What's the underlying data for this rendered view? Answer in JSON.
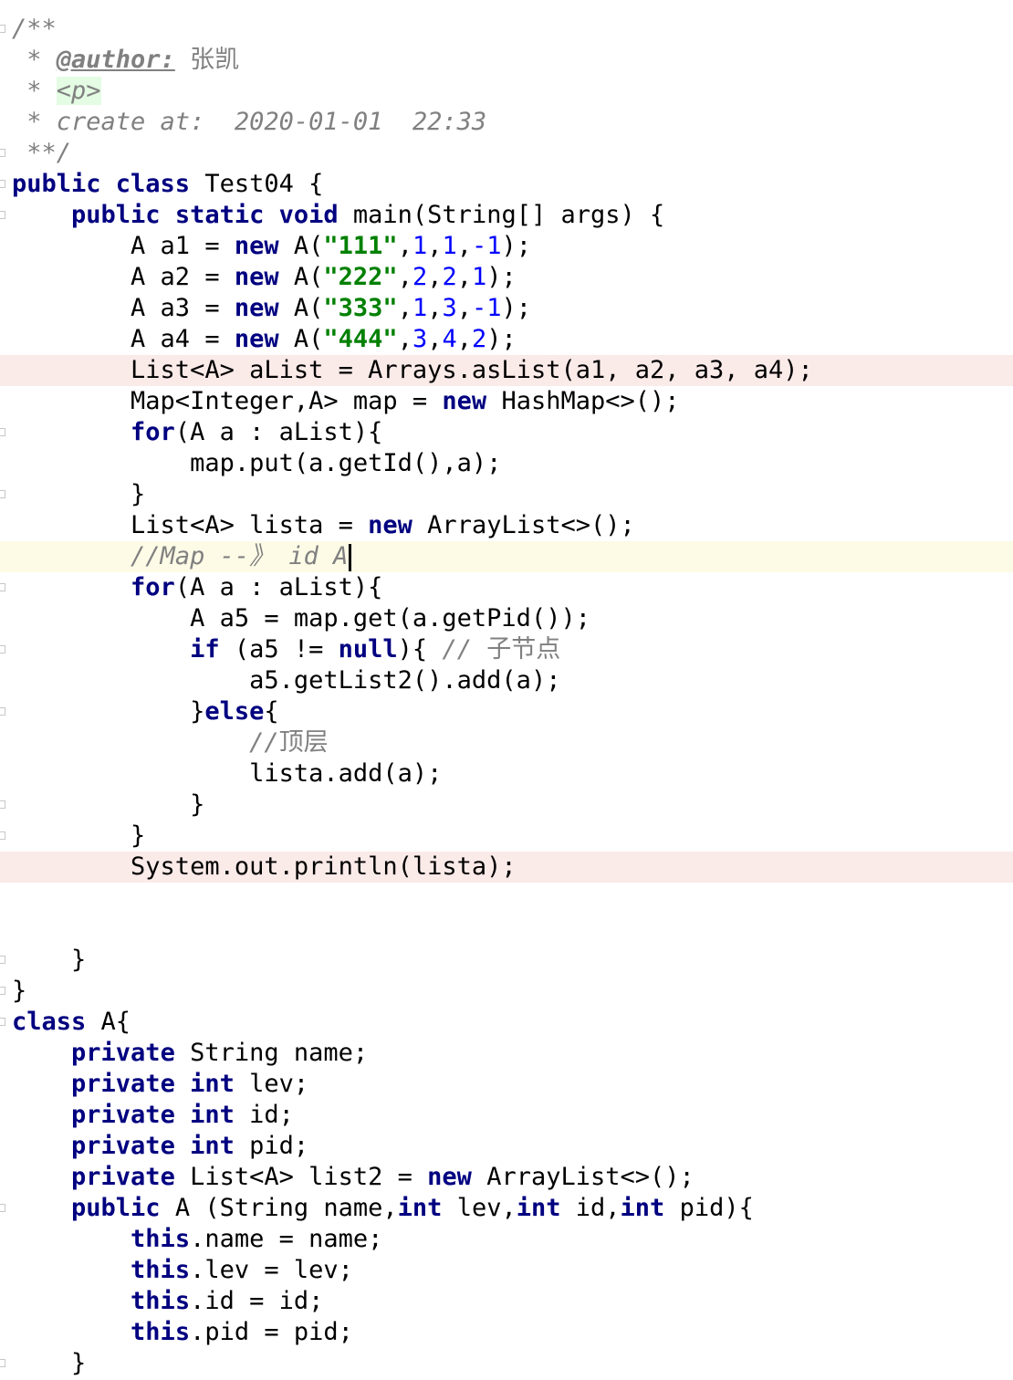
{
  "editor": {
    "lines": [
      {
        "hl": "",
        "fold": true,
        "tokens": [
          {
            "t": "/**",
            "c": "cm"
          }
        ]
      },
      {
        "hl": "",
        "fold": false,
        "tokens": [
          {
            "t": " * ",
            "c": "cm"
          },
          {
            "t": "@author:",
            "c": "anno"
          },
          {
            "t": " ",
            "c": "cm"
          },
          {
            "t": "张凯",
            "c": "cmcn"
          }
        ]
      },
      {
        "hl": "",
        "fold": false,
        "tokens": [
          {
            "t": " * ",
            "c": "cm"
          },
          {
            "t": "<p>",
            "c": "tag"
          }
        ]
      },
      {
        "hl": "",
        "fold": false,
        "tokens": [
          {
            "t": " * create at:  2020-01-01  22:33",
            "c": "cm"
          }
        ]
      },
      {
        "hl": "",
        "fold": true,
        "tokens": [
          {
            "t": " **/",
            "c": "cm"
          }
        ]
      },
      {
        "hl": "",
        "fold": true,
        "tokens": [
          {
            "t": "public class",
            "c": "kw"
          },
          {
            "t": " Test04 {",
            "c": ""
          }
        ]
      },
      {
        "hl": "",
        "fold": true,
        "tokens": [
          {
            "t": "    ",
            "c": ""
          },
          {
            "t": "public static void",
            "c": "kw"
          },
          {
            "t": " main(String[] args) {",
            "c": ""
          }
        ]
      },
      {
        "hl": "",
        "fold": false,
        "tokens": [
          {
            "t": "        A a1 = ",
            "c": ""
          },
          {
            "t": "new",
            "c": "kw"
          },
          {
            "t": " A(",
            "c": ""
          },
          {
            "t": "\"111\"",
            "c": "str"
          },
          {
            "t": ",",
            "c": ""
          },
          {
            "t": "1",
            "c": "num"
          },
          {
            "t": ",",
            "c": ""
          },
          {
            "t": "1",
            "c": "num"
          },
          {
            "t": ",",
            "c": ""
          },
          {
            "t": "-1",
            "c": "num"
          },
          {
            "t": ");",
            "c": ""
          }
        ]
      },
      {
        "hl": "",
        "fold": false,
        "tokens": [
          {
            "t": "        A a2 = ",
            "c": ""
          },
          {
            "t": "new",
            "c": "kw"
          },
          {
            "t": " A(",
            "c": ""
          },
          {
            "t": "\"222\"",
            "c": "str"
          },
          {
            "t": ",",
            "c": ""
          },
          {
            "t": "2",
            "c": "num"
          },
          {
            "t": ",",
            "c": ""
          },
          {
            "t": "2",
            "c": "num"
          },
          {
            "t": ",",
            "c": ""
          },
          {
            "t": "1",
            "c": "num"
          },
          {
            "t": ");",
            "c": ""
          }
        ]
      },
      {
        "hl": "",
        "fold": false,
        "tokens": [
          {
            "t": "        A a3 = ",
            "c": ""
          },
          {
            "t": "new",
            "c": "kw"
          },
          {
            "t": " A(",
            "c": ""
          },
          {
            "t": "\"333\"",
            "c": "str"
          },
          {
            "t": ",",
            "c": ""
          },
          {
            "t": "1",
            "c": "num"
          },
          {
            "t": ",",
            "c": ""
          },
          {
            "t": "3",
            "c": "num"
          },
          {
            "t": ",",
            "c": ""
          },
          {
            "t": "-1",
            "c": "num"
          },
          {
            "t": ");",
            "c": ""
          }
        ]
      },
      {
        "hl": "",
        "fold": false,
        "tokens": [
          {
            "t": "        A a4 = ",
            "c": ""
          },
          {
            "t": "new",
            "c": "kw"
          },
          {
            "t": " A(",
            "c": ""
          },
          {
            "t": "\"444\"",
            "c": "str"
          },
          {
            "t": ",",
            "c": ""
          },
          {
            "t": "3",
            "c": "num"
          },
          {
            "t": ",",
            "c": ""
          },
          {
            "t": "4",
            "c": "num"
          },
          {
            "t": ",",
            "c": ""
          },
          {
            "t": "2",
            "c": "num"
          },
          {
            "t": ");",
            "c": ""
          }
        ]
      },
      {
        "hl": "red",
        "fold": false,
        "tokens": [
          {
            "t": "        List<A> aList = Arrays.asList(a1, a2, a3, a4);",
            "c": ""
          }
        ]
      },
      {
        "hl": "",
        "fold": false,
        "tokens": [
          {
            "t": "        Map<Integer,A> map = ",
            "c": ""
          },
          {
            "t": "new",
            "c": "kw"
          },
          {
            "t": " HashMap<>();",
            "c": ""
          }
        ]
      },
      {
        "hl": "",
        "fold": true,
        "tokens": [
          {
            "t": "        ",
            "c": ""
          },
          {
            "t": "for",
            "c": "kw"
          },
          {
            "t": "(A a : aList){",
            "c": ""
          }
        ]
      },
      {
        "hl": "",
        "fold": false,
        "tokens": [
          {
            "t": "            map.put(a.getId(),a);",
            "c": ""
          }
        ]
      },
      {
        "hl": "",
        "fold": true,
        "tokens": [
          {
            "t": "        }",
            "c": ""
          }
        ]
      },
      {
        "hl": "",
        "fold": false,
        "tokens": [
          {
            "t": "        List<A> lista = ",
            "c": ""
          },
          {
            "t": "new",
            "c": "kw"
          },
          {
            "t": " ArrayList<>();",
            "c": ""
          }
        ]
      },
      {
        "hl": "yellow",
        "fold": false,
        "caret": true,
        "tokens": [
          {
            "t": "        ",
            "c": ""
          },
          {
            "t": "//Map --》 id A",
            "c": "cm"
          }
        ]
      },
      {
        "hl": "",
        "fold": true,
        "tokens": [
          {
            "t": "        ",
            "c": ""
          },
          {
            "t": "for",
            "c": "kw"
          },
          {
            "t": "(A a : aList){",
            "c": ""
          }
        ]
      },
      {
        "hl": "",
        "fold": false,
        "tokens": [
          {
            "t": "            A a5 = map.get(a.getPid());",
            "c": ""
          }
        ]
      },
      {
        "hl": "",
        "fold": true,
        "tokens": [
          {
            "t": "            ",
            "c": ""
          },
          {
            "t": "if",
            "c": "kw"
          },
          {
            "t": " (a5 != ",
            "c": ""
          },
          {
            "t": "null",
            "c": "kw"
          },
          {
            "t": "){ ",
            "c": ""
          },
          {
            "t": "// ",
            "c": "cm"
          },
          {
            "t": "子节点",
            "c": "cmcn"
          }
        ]
      },
      {
        "hl": "",
        "fold": false,
        "tokens": [
          {
            "t": "                a5.getList2().add(a);",
            "c": ""
          }
        ]
      },
      {
        "hl": "",
        "fold": true,
        "tokens": [
          {
            "t": "            }",
            "c": ""
          },
          {
            "t": "else",
            "c": "kw"
          },
          {
            "t": "{",
            "c": ""
          }
        ]
      },
      {
        "hl": "",
        "fold": false,
        "tokens": [
          {
            "t": "                ",
            "c": ""
          },
          {
            "t": "//",
            "c": "cm"
          },
          {
            "t": "顶层",
            "c": "cmcn"
          }
        ]
      },
      {
        "hl": "",
        "fold": false,
        "tokens": [
          {
            "t": "                lista.add(a);",
            "c": ""
          }
        ]
      },
      {
        "hl": "",
        "fold": true,
        "tokens": [
          {
            "t": "            }",
            "c": ""
          }
        ]
      },
      {
        "hl": "",
        "fold": true,
        "tokens": [
          {
            "t": "        }",
            "c": ""
          }
        ]
      },
      {
        "hl": "red",
        "fold": false,
        "tokens": [
          {
            "t": "        System.out.println(lista);",
            "c": ""
          }
        ]
      },
      {
        "hl": "",
        "fold": false,
        "tokens": []
      },
      {
        "hl": "",
        "fold": false,
        "tokens": []
      },
      {
        "hl": "",
        "fold": true,
        "tokens": [
          {
            "t": "    }",
            "c": ""
          }
        ]
      },
      {
        "hl": "",
        "fold": true,
        "tokens": [
          {
            "t": "}",
            "c": ""
          }
        ]
      },
      {
        "hl": "",
        "fold": true,
        "tokens": [
          {
            "t": "class",
            "c": "kw"
          },
          {
            "t": " A{",
            "c": ""
          }
        ]
      },
      {
        "hl": "",
        "fold": false,
        "tokens": [
          {
            "t": "    ",
            "c": ""
          },
          {
            "t": "private",
            "c": "kw"
          },
          {
            "t": " String name;",
            "c": ""
          }
        ]
      },
      {
        "hl": "",
        "fold": false,
        "tokens": [
          {
            "t": "    ",
            "c": ""
          },
          {
            "t": "private int",
            "c": "kw"
          },
          {
            "t": " lev;",
            "c": ""
          }
        ]
      },
      {
        "hl": "",
        "fold": false,
        "tokens": [
          {
            "t": "    ",
            "c": ""
          },
          {
            "t": "private int",
            "c": "kw"
          },
          {
            "t": " id;",
            "c": ""
          }
        ]
      },
      {
        "hl": "",
        "fold": false,
        "tokens": [
          {
            "t": "    ",
            "c": ""
          },
          {
            "t": "private int",
            "c": "kw"
          },
          {
            "t": " pid;",
            "c": ""
          }
        ]
      },
      {
        "hl": "",
        "fold": false,
        "tokens": [
          {
            "t": "    ",
            "c": ""
          },
          {
            "t": "private",
            "c": "kw"
          },
          {
            "t": " List<A> list2 = ",
            "c": ""
          },
          {
            "t": "new",
            "c": "kw"
          },
          {
            "t": " ArrayList<>();",
            "c": ""
          }
        ]
      },
      {
        "hl": "",
        "fold": true,
        "tokens": [
          {
            "t": "    ",
            "c": ""
          },
          {
            "t": "public",
            "c": "kw"
          },
          {
            "t": " A (String name,",
            "c": ""
          },
          {
            "t": "int",
            "c": "kw"
          },
          {
            "t": " lev,",
            "c": ""
          },
          {
            "t": "int",
            "c": "kw"
          },
          {
            "t": " id,",
            "c": ""
          },
          {
            "t": "int",
            "c": "kw"
          },
          {
            "t": " pid){",
            "c": ""
          }
        ]
      },
      {
        "hl": "",
        "fold": false,
        "tokens": [
          {
            "t": "        ",
            "c": ""
          },
          {
            "t": "this",
            "c": "kw"
          },
          {
            "t": ".name = name;",
            "c": ""
          }
        ]
      },
      {
        "hl": "",
        "fold": false,
        "tokens": [
          {
            "t": "        ",
            "c": ""
          },
          {
            "t": "this",
            "c": "kw"
          },
          {
            "t": ".lev = lev;",
            "c": ""
          }
        ]
      },
      {
        "hl": "",
        "fold": false,
        "tokens": [
          {
            "t": "        ",
            "c": ""
          },
          {
            "t": "this",
            "c": "kw"
          },
          {
            "t": ".id = id;",
            "c": ""
          }
        ]
      },
      {
        "hl": "",
        "fold": false,
        "tokens": [
          {
            "t": "        ",
            "c": ""
          },
          {
            "t": "this",
            "c": "kw"
          },
          {
            "t": ".pid = pid;",
            "c": ""
          }
        ]
      },
      {
        "hl": "",
        "fold": true,
        "tokens": [
          {
            "t": "    }",
            "c": ""
          }
        ]
      }
    ]
  }
}
